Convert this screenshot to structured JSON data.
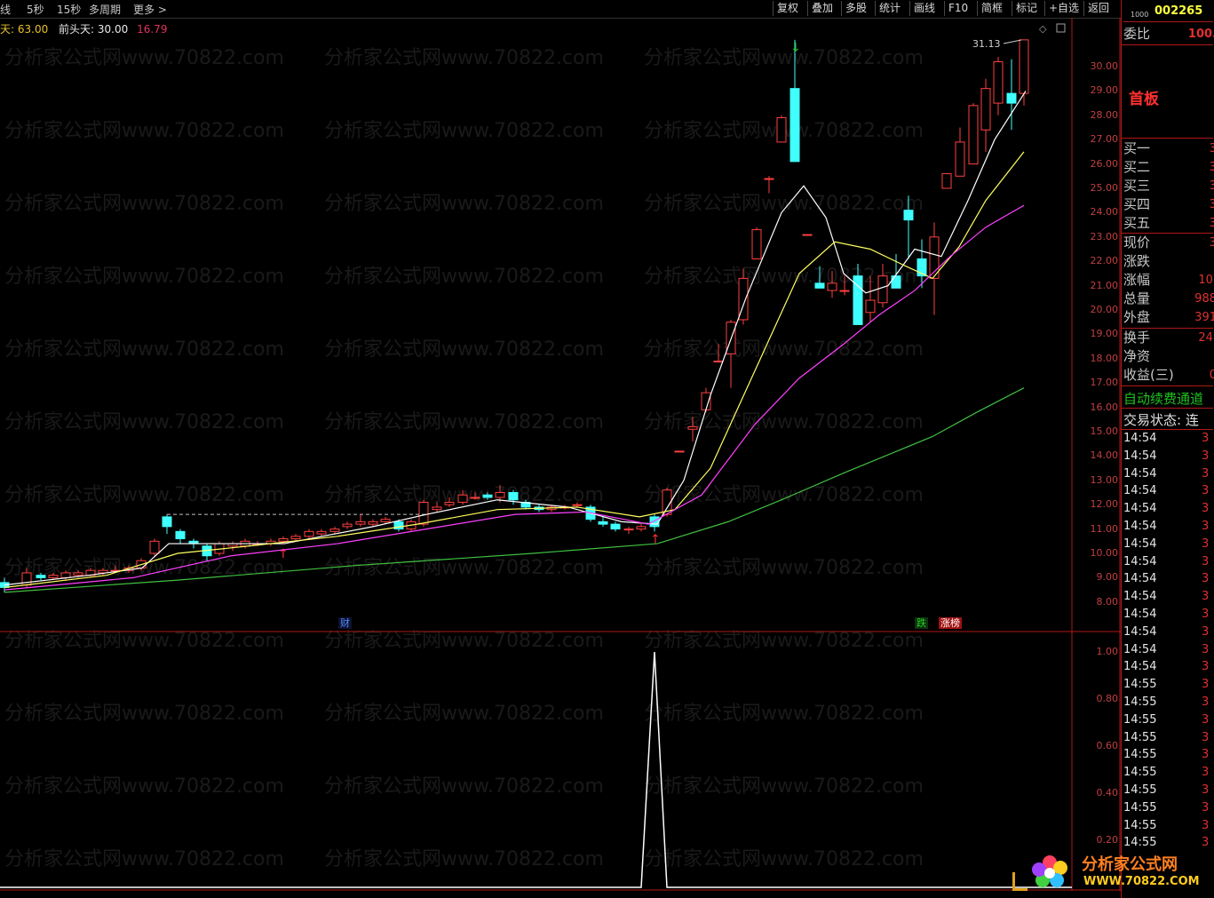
{
  "toolbar": {
    "left_items": [
      "线",
      "5秒",
      "15秒",
      "多周期",
      "更多 >"
    ],
    "right_buttons": [
      "复权",
      "叠加",
      "多股",
      "统计",
      "画线",
      "F10",
      "简框",
      "标记",
      "+自选",
      "返回"
    ]
  },
  "info": {
    "label1": "天: 63.00",
    "label2": "前头天: 30.00",
    "value3": "16.79"
  },
  "price_axis": [
    "30.00",
    "29.00",
    "28.00",
    "27.00",
    "26.00",
    "25.00",
    "24.00",
    "23.00",
    "22.00",
    "21.00",
    "20.00",
    "19.00",
    "18.00",
    "17.00",
    "16.00",
    "15.00",
    "14.00",
    "13.00",
    "12.00",
    "11.00",
    "10.00",
    "9.00",
    "8.00"
  ],
  "indicator_axis": [
    "1.00",
    "0.80",
    "0.60",
    "0.40",
    "0.20"
  ],
  "max_label": "31.13",
  "markers": {
    "cai": "财",
    "die": "跌",
    "zhangbang": "涨榜"
  },
  "right_panel": {
    "code": "002265",
    "code_prefix": "1000",
    "weibi_label": "委比",
    "weibi_value": "100.",
    "shouban": "首板",
    "buy_rows": [
      {
        "label": "买一",
        "value": "3"
      },
      {
        "label": "买二",
        "value": "3"
      },
      {
        "label": "买三",
        "value": "3"
      },
      {
        "label": "买四",
        "value": "3"
      },
      {
        "label": "买五",
        "value": "3"
      }
    ],
    "stats": [
      {
        "label": "现价",
        "value": "3"
      },
      {
        "label": "涨跌",
        "value": ""
      },
      {
        "label": "涨幅",
        "value": "10."
      },
      {
        "label": "总量",
        "value": "988"
      },
      {
        "label": "外盘",
        "value": "391"
      }
    ],
    "stats2": [
      {
        "label": "换手",
        "value": "24."
      },
      {
        "label": "净资",
        "value": ""
      },
      {
        "label": "收益(三)",
        "value": "0"
      }
    ],
    "promo": "自动续费通道",
    "trade_status": "交易状态: 连",
    "ticks": [
      "14:54",
      "14:54",
      "14:54",
      "14:54",
      "14:54",
      "14:54",
      "14:54",
      "14:54",
      "14:54",
      "14:54",
      "14:54",
      "14:54",
      "14:54",
      "14:54",
      "14:55",
      "14:55",
      "14:55",
      "14:55",
      "14:55",
      "14:55",
      "14:55",
      "14:55",
      "14:55",
      "14:55"
    ],
    "tick_value": "3"
  },
  "watermark": "分析家公式网www.70822.com",
  "logo": {
    "title": "分析家公式网",
    "url": "WWW.70822.COM"
  },
  "colors": {
    "up": "#ff4040",
    "down": "#40ffff",
    "ma5": "#ffffff",
    "ma10": "#ffff60",
    "ma20": "#ff40ff",
    "ma60": "#40c040",
    "axis": "#b01818"
  }
}
